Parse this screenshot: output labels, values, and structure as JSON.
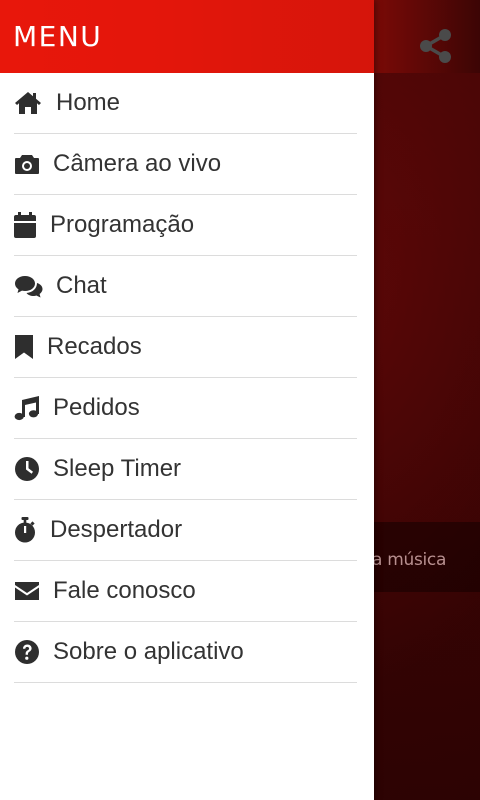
{
  "drawer": {
    "title": "MENU",
    "items": [
      {
        "label": "Home",
        "icon": "home-icon"
      },
      {
        "label": "Câmera ao vivo",
        "icon": "camera-icon"
      },
      {
        "label": "Programação",
        "icon": "calendar-icon"
      },
      {
        "label": "Chat",
        "icon": "chat-icon"
      },
      {
        "label": "Recados",
        "icon": "bookmark-icon"
      },
      {
        "label": "Pedidos",
        "icon": "music-note-icon"
      },
      {
        "label": "Sleep Timer",
        "icon": "clock-icon"
      },
      {
        "label": "Despertador",
        "icon": "stopwatch-icon"
      },
      {
        "label": "Fale conosco",
        "icon": "envelope-icon"
      },
      {
        "label": "Sobre o aplicativo",
        "icon": "question-circle-icon"
      }
    ]
  },
  "background": {
    "now_playing_partial": "a música",
    "share_icon": "share-icon"
  },
  "colors": {
    "brand_red": "#e8170b",
    "icon_dark": "#2e2e2e",
    "text_dark": "#333333",
    "divider": "#dcdcdc"
  }
}
